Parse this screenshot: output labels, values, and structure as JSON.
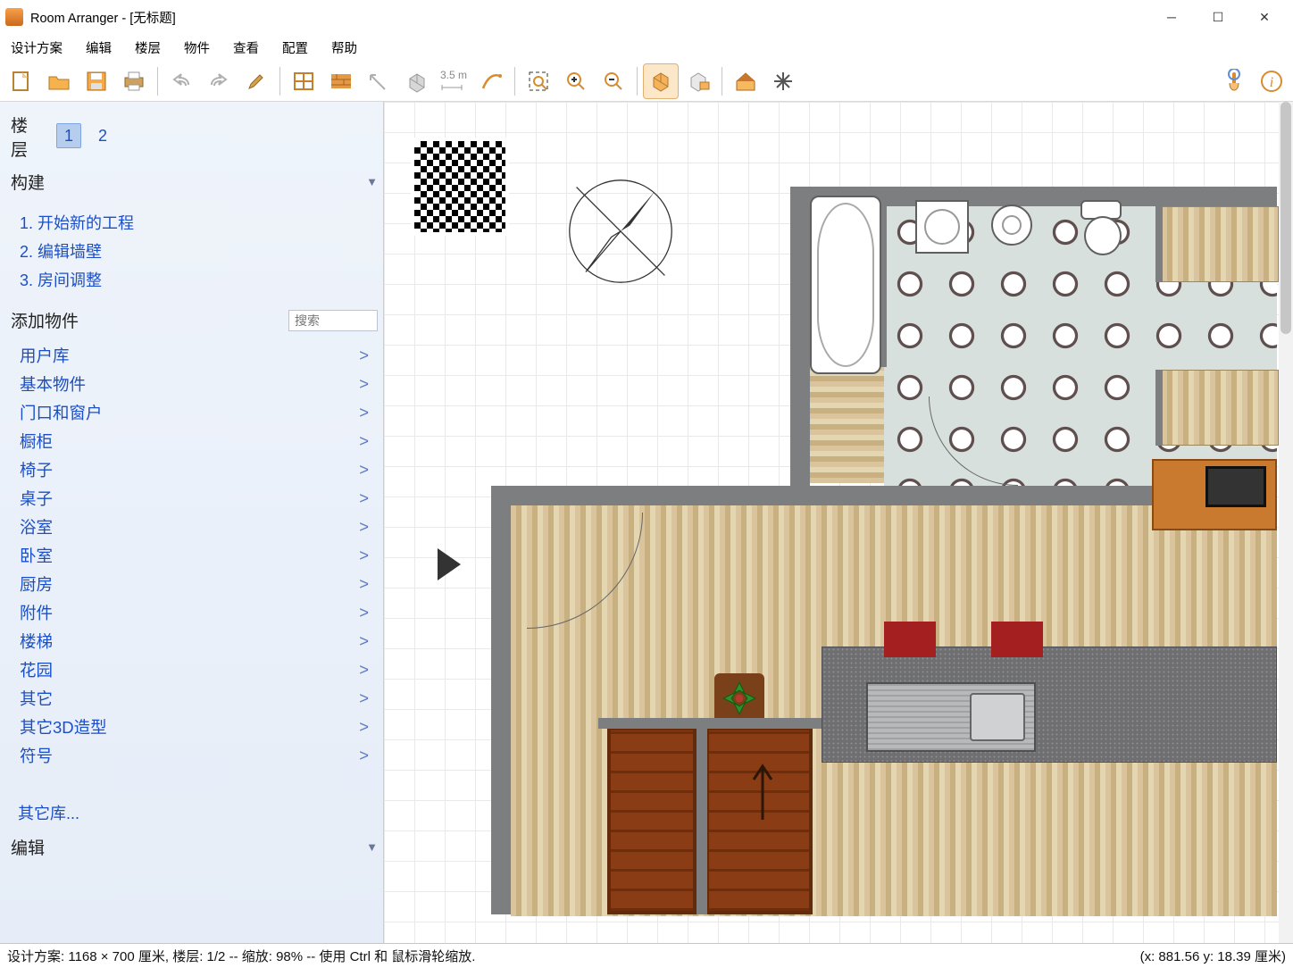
{
  "title": "Room Arranger - [无标题]",
  "menus": [
    "设计方案",
    "编辑",
    "楼层",
    "物件",
    "查看",
    "配置",
    "帮助"
  ],
  "toolbar_icons": [
    "new",
    "open",
    "save",
    "print",
    "undo",
    "redo",
    "brush",
    "room",
    "wall",
    "wall-angle",
    "3d-box",
    "measure",
    "line",
    "zoom-fit",
    "zoom-in",
    "zoom-out",
    "box-view",
    "3d-view",
    "house",
    "spark"
  ],
  "toolbar_right_icons": [
    "touch",
    "info"
  ],
  "sidebar": {
    "floors_label": "楼层",
    "floors": [
      "1",
      "2"
    ],
    "active_floor": "1",
    "build_label": "构建",
    "build_items": [
      "1. 开始新的工程",
      "2. 编辑墙壁",
      "3. 房间调整"
    ],
    "addobj_label": "添加物件",
    "search_placeholder": "搜索",
    "categories": [
      "用户库",
      "基本物件",
      "门口和窗户",
      "橱柜",
      "椅子",
      "桌子",
      "浴室",
      "卧室",
      "厨房",
      "附件",
      "楼梯",
      "花园",
      "其它",
      "其它3D造型",
      "符号"
    ],
    "other_lib": "其它库...",
    "edit_label": "编辑"
  },
  "status_left": "设计方案: 1168 × 700 厘米, 楼层: 1/2 -- 缩放: 98% -- 使用 Ctrl 和 鼠标滑轮缩放.",
  "status_right": "(x: 881.56 y: 18.39 厘米)"
}
